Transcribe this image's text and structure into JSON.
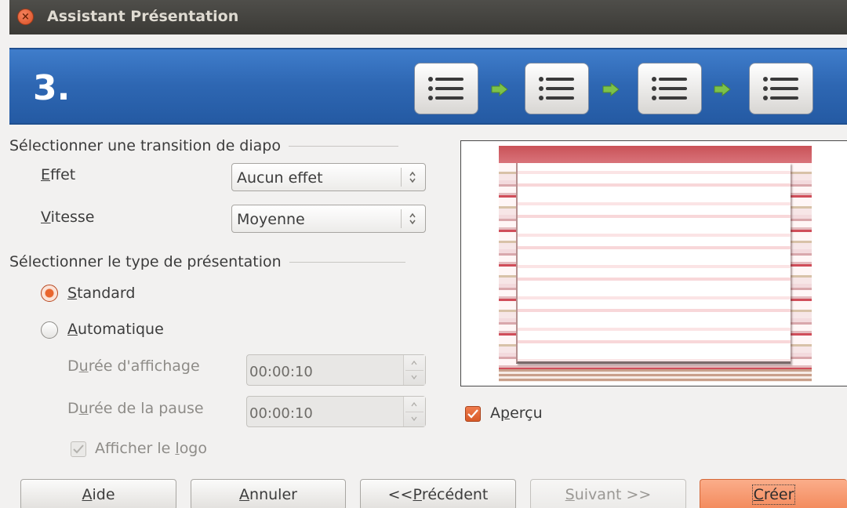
{
  "window": {
    "title": "Assistant Présentation"
  },
  "banner": {
    "step": "3.",
    "step_icons": [
      "list-icon",
      "list-icon",
      "list-icon",
      "list-icon"
    ],
    "arrow_icon": "green-arrow-right-icon"
  },
  "transition_group": {
    "title": "Sélectionner une transition de diapo",
    "effect": {
      "label_accel": "E",
      "label_rest": "ffet",
      "value": "Aucun effet"
    },
    "speed": {
      "label_accel": "V",
      "label_rest": "itesse",
      "value": "Moyenne"
    }
  },
  "type_group": {
    "title": "Sélectionner le type de présentation",
    "standard": {
      "label_accel": "S",
      "label_rest": "tandard",
      "checked": true
    },
    "automatic": {
      "label_accel": "A",
      "label_rest": "utomatique",
      "checked": false
    },
    "display_duration": {
      "label_pre": "D",
      "label_accel": "u",
      "label_rest": "rée d'affichage",
      "value": "00:00:10"
    },
    "pause_duration": {
      "label_pre": "D",
      "label_accel": "u",
      "label_rest": "rée de la pause",
      "value": "00:00:10"
    },
    "show_logo": {
      "label_pre": "Afficher le ",
      "label_accel": "l",
      "label_rest": "ogo",
      "checked": true,
      "enabled": false
    }
  },
  "preview": {
    "checkbox": {
      "label_pre": "A",
      "label_accel": "p",
      "label_rest": "erçu",
      "checked": true
    }
  },
  "buttons": {
    "help": {
      "accel": "A",
      "rest": "ide"
    },
    "cancel": {
      "accel": "A",
      "rest": "nnuler"
    },
    "back": {
      "pre": "<< ",
      "accel": "P",
      "rest": "récédent"
    },
    "next": {
      "accel": "S",
      "rest": "uivant >>",
      "enabled": false
    },
    "create": {
      "pre": "",
      "accel": "C",
      "rest": "réer"
    }
  },
  "colors": {
    "accent": "#f38a5c",
    "banner": "#2e67b3",
    "titlebar": "#3b3a36"
  }
}
